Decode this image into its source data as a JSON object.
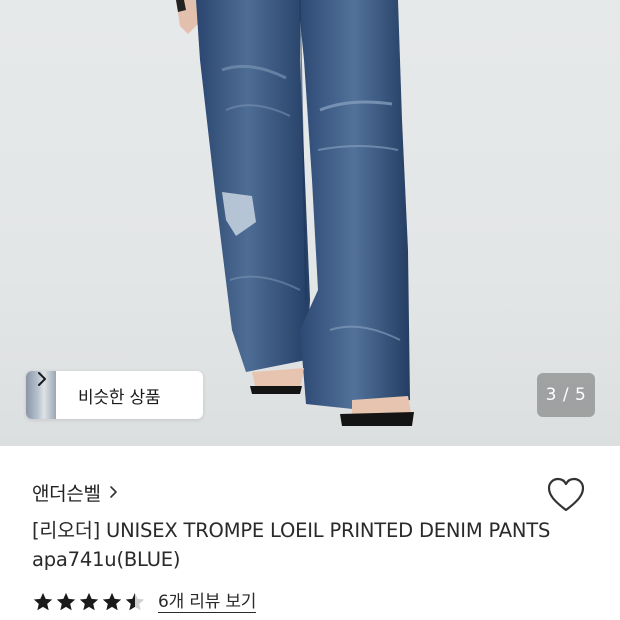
{
  "hero": {
    "similar_products_label": "비슷한 상품",
    "page_counter": "3 / 5"
  },
  "product": {
    "brand": "앤더슨벨",
    "title": "[리오더] UNISEX TROMPE LOEIL PRINTED DENIM PANTS apa741u(BLUE)",
    "rating": 4.5,
    "rating_max": 5,
    "reviews_link": "6개 리뷰 보기"
  },
  "icons": {
    "similar_chevron": "chevron-right-icon",
    "brand_chevron": "chevron-right-icon",
    "wishlist": "heart-outline-icon",
    "star": "star-icon"
  },
  "colors": {
    "denim": "#2d4a72",
    "background": "#e4e7e8",
    "star": "#1a1a1a"
  }
}
